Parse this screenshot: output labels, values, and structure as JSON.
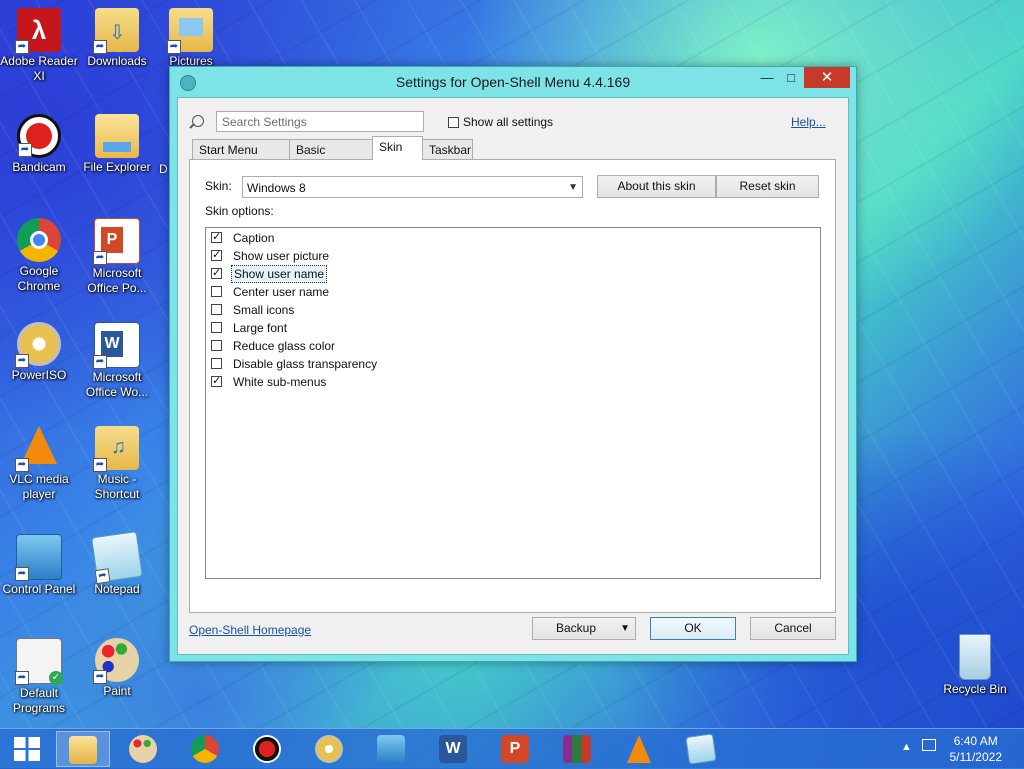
{
  "desktop": {
    "icons": [
      {
        "label": "Adobe Reader XI",
        "icon": "pdf-icon"
      },
      {
        "label": "Downloads",
        "icon": "folder-icon"
      },
      {
        "label": "Pictures",
        "icon": "folder-icon"
      },
      {
        "label": "Bandicam",
        "icon": "record-icon"
      },
      {
        "label": "File Explorer",
        "icon": "folder-icon"
      },
      {
        "label": "D",
        "icon": "folder-icon"
      },
      {
        "label": "Google Chrome",
        "icon": "chrome-icon"
      },
      {
        "label": "Microsoft Office Po...",
        "icon": "powerpoint-icon"
      },
      {
        "label": "PowerISO",
        "icon": "disc-icon"
      },
      {
        "label": "Microsoft Office Wo...",
        "icon": "word-icon"
      },
      {
        "label": "VLC media player",
        "icon": "vlc-icon"
      },
      {
        "label": "Music - Shortcut",
        "icon": "folder-icon"
      },
      {
        "label": "Control Panel",
        "icon": "control-panel-icon"
      },
      {
        "label": "Notepad",
        "icon": "notepad-icon"
      },
      {
        "label": "Default Programs",
        "icon": "default-programs-icon"
      },
      {
        "label": "Paint",
        "icon": "paint-icon"
      },
      {
        "label": "Recycle Bin",
        "icon": "recycle-bin-icon"
      }
    ]
  },
  "window": {
    "title": "Settings for Open-Shell Menu 4.4.169",
    "minimize": "—",
    "maximize": "□",
    "close": "✕",
    "search_placeholder": "Search Settings",
    "show_all_settings": "Show all settings",
    "help": "Help...",
    "tabs": [
      "Start Menu Style",
      "Basic Settings",
      "Skin",
      "Taskbar"
    ],
    "active_tab": "Skin",
    "skin_label": "Skin:",
    "skin_value": "Windows 8",
    "about_skin": "About this skin",
    "reset_skin": "Reset skin",
    "skin_options_label": "Skin options:",
    "options": [
      {
        "label": "Caption",
        "checked": true
      },
      {
        "label": "Show user picture",
        "checked": true
      },
      {
        "label": "Show user name",
        "checked": true,
        "selected": true
      },
      {
        "label": "Center user name",
        "checked": false
      },
      {
        "label": "Small icons",
        "checked": false
      },
      {
        "label": "Large font",
        "checked": false
      },
      {
        "label": "Reduce glass color",
        "checked": false
      },
      {
        "label": "Disable glass transparency",
        "checked": false
      },
      {
        "label": "White sub-menus",
        "checked": true
      }
    ],
    "homepage": "Open-Shell Homepage",
    "backup": "Backup",
    "ok": "OK",
    "cancel": "Cancel"
  },
  "taskbar": {
    "time": "6:40 AM",
    "date": "5/11/2022",
    "apps": [
      "start-icon",
      "file-explorer-icon",
      "paint-icon",
      "chrome-icon",
      "bandicam-icon",
      "poweriso-icon",
      "control-panel-icon",
      "word-icon",
      "powerpoint-icon",
      "winrar-icon",
      "vlc-icon",
      "notepad-icon"
    ]
  }
}
